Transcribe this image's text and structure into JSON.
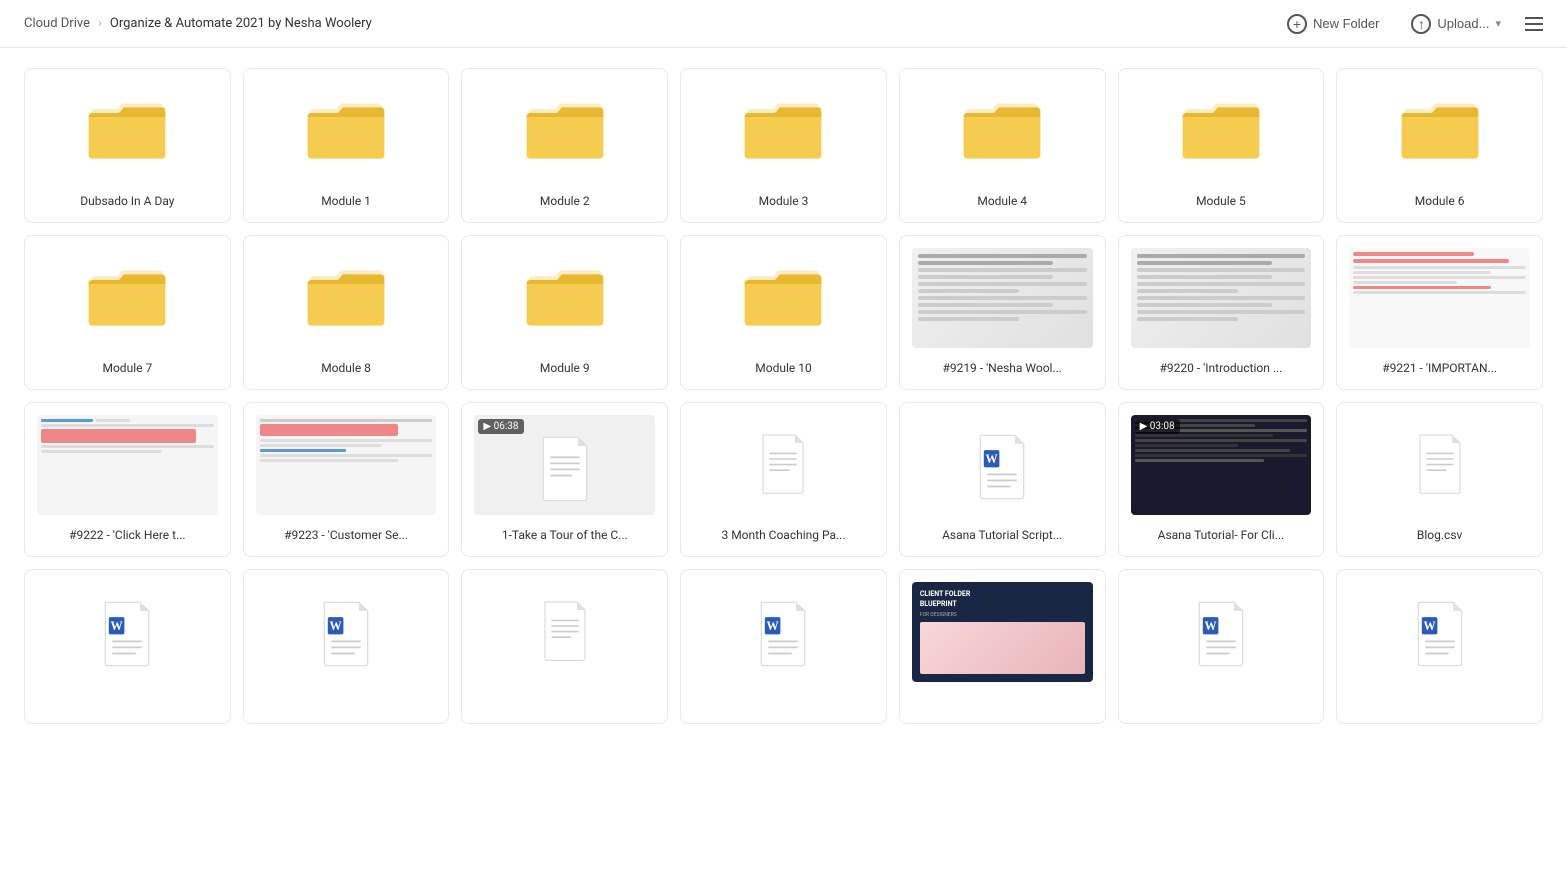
{
  "header": {
    "breadcrumb_root": "Cloud Drive",
    "breadcrumb_separator": "›",
    "breadcrumb_current": "Organize & Automate 2021 by Nesha Woolery",
    "new_folder_label": "New Folder",
    "upload_label": "Upload...",
    "menu_icon_label": "menu"
  },
  "grid": {
    "items": [
      {
        "id": "dubsado",
        "type": "folder",
        "label": "Dubsado In A Day"
      },
      {
        "id": "module1",
        "type": "folder",
        "label": "Module 1"
      },
      {
        "id": "module2",
        "type": "folder",
        "label": "Module 2"
      },
      {
        "id": "module3",
        "type": "folder",
        "label": "Module 3"
      },
      {
        "id": "module4",
        "type": "folder",
        "label": "Module 4"
      },
      {
        "id": "module5",
        "type": "folder",
        "label": "Module 5"
      },
      {
        "id": "module6",
        "type": "folder",
        "label": "Module 6"
      },
      {
        "id": "module7",
        "type": "folder",
        "label": "Module 7"
      },
      {
        "id": "module8",
        "type": "folder",
        "label": "Module 8"
      },
      {
        "id": "module9",
        "type": "folder",
        "label": "Module 9"
      },
      {
        "id": "module10",
        "type": "folder",
        "label": "Module 10"
      },
      {
        "id": "f9219",
        "type": "screenshot",
        "label": "#9219 - 'Nesha Wool...",
        "variant": "doc-list"
      },
      {
        "id": "f9220",
        "type": "screenshot",
        "label": "#9220 - 'Introduction ...",
        "variant": "doc-list"
      },
      {
        "id": "f9221",
        "type": "screenshot",
        "label": "#9221 - 'IMPORTAN...",
        "variant": "doc-pink"
      },
      {
        "id": "f9222",
        "type": "screenshot",
        "label": "#9222 - 'Click Here t...",
        "variant": "screen-mixed"
      },
      {
        "id": "f9223",
        "type": "screenshot",
        "label": "#9223 - 'Customer Se...",
        "variant": "screen-form"
      },
      {
        "id": "take-tour",
        "type": "video",
        "label": "1-Take a Tour of the C...",
        "duration": "06:38"
      },
      {
        "id": "coaching-pa",
        "type": "document",
        "label": "3 Month Coaching Pa..."
      },
      {
        "id": "asana-script",
        "type": "word",
        "label": "Asana Tutorial Script..."
      },
      {
        "id": "asana-cli",
        "type": "video-dark",
        "label": "Asana Tutorial- For Cli...",
        "duration": "03:08"
      },
      {
        "id": "blog-csv",
        "type": "document",
        "label": "Blog.csv"
      },
      {
        "id": "item22",
        "type": "word",
        "label": ""
      },
      {
        "id": "item23",
        "type": "word",
        "label": ""
      },
      {
        "id": "item24",
        "type": "document",
        "label": ""
      },
      {
        "id": "item25",
        "type": "word",
        "label": ""
      },
      {
        "id": "item26",
        "type": "blueprint",
        "label": ""
      },
      {
        "id": "item27",
        "type": "word",
        "label": ""
      },
      {
        "id": "item28",
        "type": "word",
        "label": ""
      }
    ]
  }
}
